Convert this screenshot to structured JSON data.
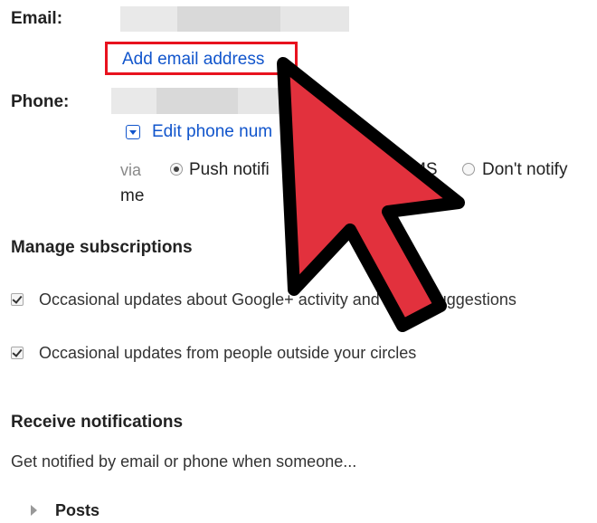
{
  "contact": {
    "email_label": "Email:",
    "add_email_link": "Add email address",
    "phone_label": "Phone:",
    "edit_phone_link": "Edit phone num",
    "via_label": "via",
    "options": [
      {
        "label": "Push notifi",
        "selected": true
      },
      {
        "label": "MS",
        "selected": false
      },
      {
        "label": "Don't notify",
        "selected": false
      }
    ],
    "me_text": "me"
  },
  "subscriptions": {
    "title": "Manage subscriptions",
    "items": [
      {
        "label": "Occasional updates about Google+ activity and friend suggestions",
        "checked": true
      },
      {
        "label": "Occasional updates from people outside your circles",
        "checked": true
      }
    ]
  },
  "notifications": {
    "title": "Receive notifications",
    "description": "Get notified by email or phone when someone...",
    "posts_label": "Posts"
  },
  "colors": {
    "link": "#1155cc",
    "highlight_border": "#e8121e",
    "arrow_fill": "#e2313d",
    "arrow_outline": "#000000"
  },
  "icons": {
    "cursor": "red-arrow-cursor-icon",
    "dropdown": "dropdown-arrow-icon",
    "expand": "triangle-right-icon",
    "checkbox": "checkbox-icon",
    "radio": "radio-icon"
  }
}
